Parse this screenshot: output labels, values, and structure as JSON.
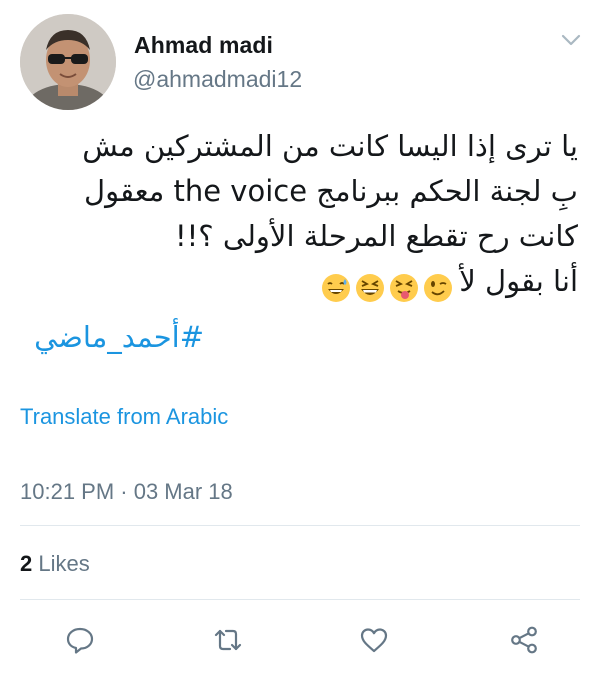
{
  "author": {
    "display_name": "Ahmad madi",
    "handle": "@ahmadmadi12",
    "avatar_icon": "profile-photo-man-sunglasses"
  },
  "menu": {
    "icon": "chevron-down-icon"
  },
  "tweet": {
    "lines": [
      "يا ترى إذا اليسا كانت من المشتركين مش",
      "بِ لجنة الحكم ببرنامج the voice معقول",
      "كانت رح تقطع المرحلة الأولى ؟!!",
      "أنا بقول لأ"
    ],
    "emojis": [
      "winking-face",
      "squinting-tongue-face",
      "grinning-squinting-face",
      "grinning-sweat-face"
    ],
    "hashtag": "#أحمد_ماضي"
  },
  "translate_label": "Translate from Arabic",
  "timestamp": "10:21 PM · 03 Mar 18",
  "stats": {
    "likes_count": "2",
    "likes_label": "Likes"
  },
  "actions": [
    {
      "name": "reply",
      "icon": "reply-icon"
    },
    {
      "name": "retweet",
      "icon": "retweet-icon"
    },
    {
      "name": "like",
      "icon": "heart-icon"
    },
    {
      "name": "share",
      "icon": "share-icon"
    }
  ],
  "colors": {
    "link": "#1b95e0",
    "secondary_text": "#657786",
    "primary_text": "#14171a",
    "divider": "#e1e8ed",
    "emoji_yellow": "#ffcc4d"
  }
}
